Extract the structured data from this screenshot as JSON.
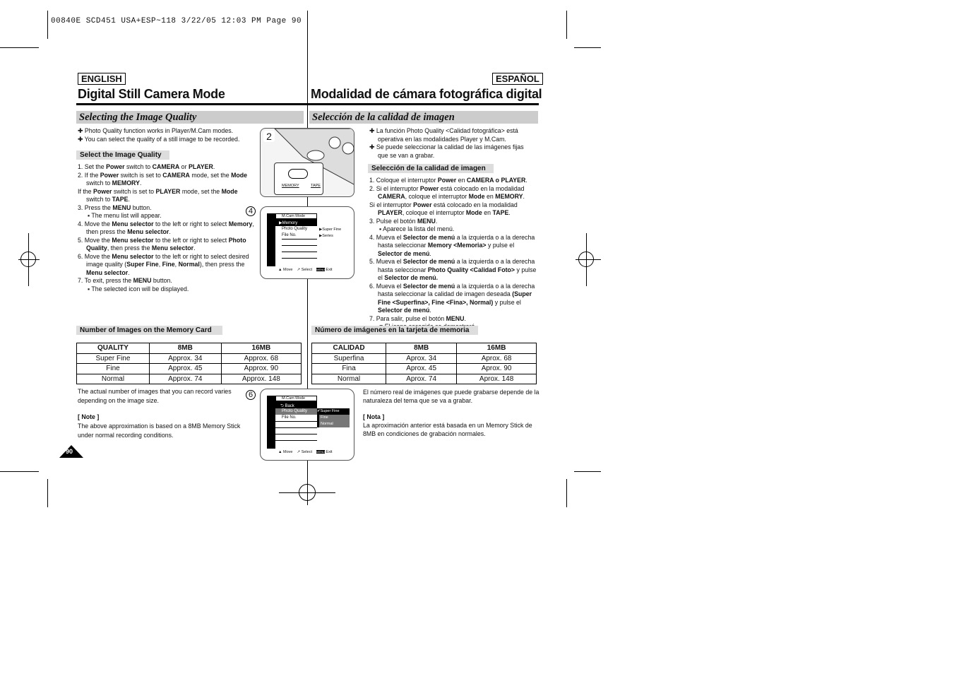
{
  "header": "00840E SCD451 USA+ESP~118  3/22/05 12:03 PM  Page 90",
  "english": {
    "lang": "ENGLISH",
    "title": "Digital Still Camera Mode",
    "section": "Selecting the Image Quality",
    "bullets": [
      "Photo Quality function works in Player/M.Cam modes.",
      "You can select the quality of a still image to be recorded."
    ],
    "sub1": "Select the Image Quality",
    "steps": [
      [
        [
          "1. Set the "
        ],
        [
          "Power",
          1
        ],
        [
          " switch to "
        ],
        [
          "CAMERA",
          1
        ],
        [
          " or "
        ],
        [
          "PLAYER",
          1
        ],
        [
          "."
        ]
      ],
      [
        [
          "2. If the "
        ],
        [
          "Power",
          1
        ],
        [
          " switch is set to "
        ],
        [
          "CAMERA",
          1
        ],
        [
          " mode, set the "
        ],
        [
          "Mode",
          1
        ],
        [
          " switch to "
        ],
        [
          "MEMORY",
          1
        ],
        [
          "."
        ]
      ],
      [
        [
          "If the "
        ],
        [
          "Power",
          1
        ],
        [
          " switch is set to "
        ],
        [
          "PLAYER",
          1
        ],
        [
          " mode, set the "
        ],
        [
          "Mode",
          1
        ],
        [
          " switch to "
        ],
        [
          "TAPE",
          1
        ],
        [
          "."
        ]
      ],
      [
        [
          "3. Press the "
        ],
        [
          "MENU",
          1
        ],
        [
          " button."
        ]
      ],
      [
        [
          "▪ The menu list will appear."
        ]
      ],
      [
        [
          "4. Move the "
        ],
        [
          "Menu selector",
          1
        ],
        [
          " to the left or right to select "
        ],
        [
          "Memory",
          1
        ],
        [
          ", then press the "
        ],
        [
          "Menu selector",
          1
        ],
        [
          "."
        ]
      ],
      [
        [
          "5. Move the "
        ],
        [
          "Menu selector",
          1
        ],
        [
          " to the left or right to select "
        ],
        [
          "Photo Quality",
          1
        ],
        [
          ", then press the "
        ],
        [
          "Menu selector",
          1
        ],
        [
          "."
        ]
      ],
      [
        [
          "6. Move the "
        ],
        [
          "Menu selector",
          1
        ],
        [
          " to the left or right to select desired image quality ("
        ],
        [
          "Super Fine",
          1
        ],
        [
          ", "
        ],
        [
          "Fine",
          1
        ],
        [
          ", "
        ],
        [
          "Normal",
          1
        ],
        [
          "), then press the "
        ],
        [
          "Menu selector",
          1
        ],
        [
          "."
        ]
      ],
      [
        [
          "7. To exit, press the "
        ],
        [
          "MENU",
          1
        ],
        [
          " button."
        ]
      ],
      [
        [
          "▪ The selected icon will be displayed."
        ]
      ]
    ],
    "sub2": "Number of Images on the Memory Card",
    "table": {
      "headers": [
        "QUALITY",
        "8MB",
        "16MB"
      ],
      "rows": [
        [
          "Super Fine",
          "Approx. 34",
          "Approx. 68"
        ],
        [
          "Fine",
          "Approx. 45",
          "Approx. 90"
        ],
        [
          "Normal",
          "Approx. 74",
          "Approx. 148"
        ]
      ]
    },
    "footnote": "The actual number of images that you can record varies depending on the image size.",
    "note_label": "[ Note ]",
    "note": "The above approximation is based on a 8MB Memory Stick under normal recording conditions.",
    "page": "90"
  },
  "espanol": {
    "lang": "ESPAÑOL",
    "title": "Modalidad de cámara fotográfica digital",
    "section": "Selección de la calidad de imagen",
    "bullets": [
      "La función Photo Quality <Calidad fotográfica> está operativa en las modalidades Player y M.Cam.",
      "Se puede seleccionar la calidad de las imágenes fijas que se van a grabar."
    ],
    "sub1": "Selección de la calidad de imagen",
    "steps": [
      [
        [
          "1. Coloque el interruptor "
        ],
        [
          "Power",
          1
        ],
        [
          " en "
        ],
        [
          "CAMERA o PLAYER",
          1
        ],
        [
          "."
        ]
      ],
      [
        [
          "2. Si el interruptor "
        ],
        [
          "Power",
          1
        ],
        [
          " está colocado en la modalidad "
        ],
        [
          "CAMERA",
          1
        ],
        [
          ", coloque el interruptor "
        ],
        [
          "Mode",
          1
        ],
        [
          " en "
        ],
        [
          "MEMORY",
          1
        ],
        [
          "."
        ]
      ],
      [
        [
          "Si el interruptor "
        ],
        [
          "Power",
          1
        ],
        [
          " está colocado en la modalidad "
        ],
        [
          "PLAYER",
          1
        ],
        [
          ", coloque el interruptor "
        ],
        [
          "Mode",
          1
        ],
        [
          " en "
        ],
        [
          "TAPE",
          1
        ],
        [
          "."
        ]
      ],
      [
        [
          "3. Pulse el botón "
        ],
        [
          "MENU",
          1
        ],
        [
          "."
        ]
      ],
      [
        [
          "▪ Aparece la lista del menú."
        ]
      ],
      [
        [
          "4. Mueva el "
        ],
        [
          "Selector de menú",
          1
        ],
        [
          " a la izquierda o a la derecha hasta seleccionar "
        ],
        [
          "Memory <Memoria>",
          1
        ],
        [
          " y pulse el "
        ],
        [
          "Selector de menú",
          1
        ],
        [
          "."
        ]
      ],
      [
        [
          "5. Mueva el "
        ],
        [
          "Selector de menú",
          1
        ],
        [
          " a la izquierda o a la derecha hasta seleccionar "
        ],
        [
          "Photo Quality <Calidad Foto>",
          1
        ],
        [
          " y pulse el "
        ],
        [
          "Selector de menú.",
          1
        ]
      ],
      [
        [
          "6. Mueva el "
        ],
        [
          "Selector de menú",
          1
        ],
        [
          " a la izquierda o a la derecha hasta seleccionar la calidad de imagen deseada "
        ],
        [
          "(Super Fine <Superfina>, Fine <Fina>, Normal)",
          1
        ],
        [
          " y pulse el "
        ],
        [
          "Selector de menú",
          1
        ],
        [
          "."
        ]
      ],
      [
        [
          "7. Para salir, pulse el botón "
        ],
        [
          "MENU",
          1
        ],
        [
          "."
        ]
      ],
      [
        [
          "■ El icono escogido se demostrará."
        ]
      ]
    ],
    "sub2": "Número de imágenes en la tarjeta de memoria",
    "table": {
      "headers": [
        "CALIDAD",
        "8MB",
        "16MB"
      ],
      "rows": [
        [
          "Superfina",
          "Aprox. 34",
          "Aprox. 68"
        ],
        [
          "Fina",
          "Aprox. 45",
          "Aprox. 90"
        ],
        [
          "Normal",
          "Aprox. 74",
          "Aprox. 148"
        ]
      ]
    },
    "footnote": "El número real de imágenes que puede grabarse depende de la naturaleza del tema que se va a grabar.",
    "note_label": "[ Nota ]",
    "note": "La aproximación anterior está basada en un Memory Stick de 8MB en condiciones de grabación normales."
  },
  "fig2": {
    "num": "2",
    "memory": "MEMORY",
    "tape": "TAPE"
  },
  "fig4": {
    "num": "4",
    "mode": "M.Cam Mode",
    "items": [
      "▶Memory",
      "Photo Quality",
      "File No."
    ],
    "sub": [
      "▶Super Fine",
      "▶Series"
    ],
    "move": "Move",
    "select": "Select",
    "menu": "MENU",
    "exit": "Exit"
  },
  "fig6": {
    "num": "6",
    "mode": "M.Cam Mode",
    "items": [
      "⮌ Back",
      "Photo Quality",
      "File No."
    ],
    "opts": [
      "✔Super Fine",
      "Fine",
      "Normal"
    ],
    "move": "Move",
    "select": "Select",
    "menu": "MENU",
    "exit": "Exit"
  }
}
